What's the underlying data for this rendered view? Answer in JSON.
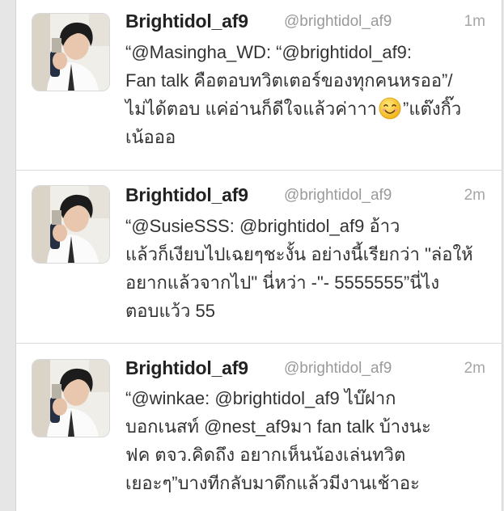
{
  "colors": {
    "name": "#222222",
    "handle": "#9a9a9a",
    "text": "#333333",
    "separator": "#dadada",
    "background": "#e6e6e6"
  },
  "tweets": [
    {
      "name": "Brightidol_af9",
      "handle": "@brightidol_af9",
      "time": "1m",
      "avatar_icon": "profile-photo",
      "lines": [
        "“@Masingha_WD: “@brightidol_af9:",
        "Fan talk คือตอบทวิตเตอร์ของทุกคนหรออ”/",
        "ไม่ได้ตอบ แค่อ่านก็ดีใจแล้วค่าาา",
        "”แต๊งกิ๊ว",
        "เน้อออ"
      ],
      "emoji": "smiling-face-emoji"
    },
    {
      "name": "Brightidol_af9",
      "handle": "@brightidol_af9",
      "time": "2m",
      "avatar_icon": "profile-photo",
      "lines": [
        "“@SusieSSS: @brightidol_af9 อ้าว",
        "แล้วก็เงียบไปเฉยๆชะงั้น อย่างนี้เรียกว่า \"ล่อให้",
        "อยากแล้วจากไป\" นี่หว่า -\"- 5555555”นี่ไง",
        "ตอบแว้ว 55"
      ]
    },
    {
      "name": "Brightidol_af9",
      "handle": "@brightidol_af9",
      "time": "2m",
      "avatar_icon": "profile-photo",
      "lines": [
        "“@winkae: @brightidol_af9   ไบ๊ฝาก",
        "บอกเนสท์ @nest_af9มา fan talk บ้างนะ",
        "ฟค ตจว.คิดถึง อยากเห็นน้องเล่นทวิต",
        "เยอะๆ”บางทีกลับมาดึกแล้วมีงานเช้าอะ"
      ]
    }
  ]
}
